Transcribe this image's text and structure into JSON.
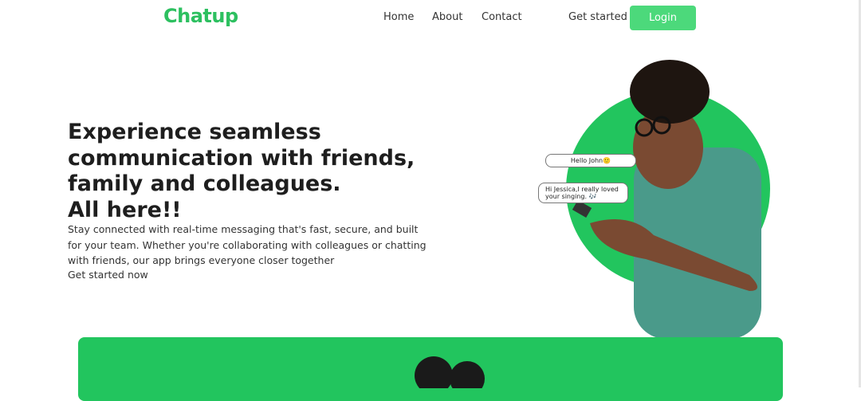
{
  "nav": {
    "logo": "Chatup",
    "links": [
      "Home",
      "About",
      "Contact"
    ],
    "get_started": "Get started",
    "login": "Login"
  },
  "hero": {
    "title_lines": [
      "Experience seamless",
      "communication with friends,",
      "family and colleagues.",
      "All here!!"
    ],
    "description": "Stay connected with real-time messaging that's fast, secure, and built for your team. Whether you're collaborating with colleagues or chatting with friends, our app brings everyone closer together",
    "cta": "Get started now",
    "bubbles": [
      "Hello John🙂",
      "Hi Jessica,I really loved your singing. 🎶"
    ]
  },
  "colors": {
    "brand": "#22c55e",
    "button": "#4cd97b"
  }
}
